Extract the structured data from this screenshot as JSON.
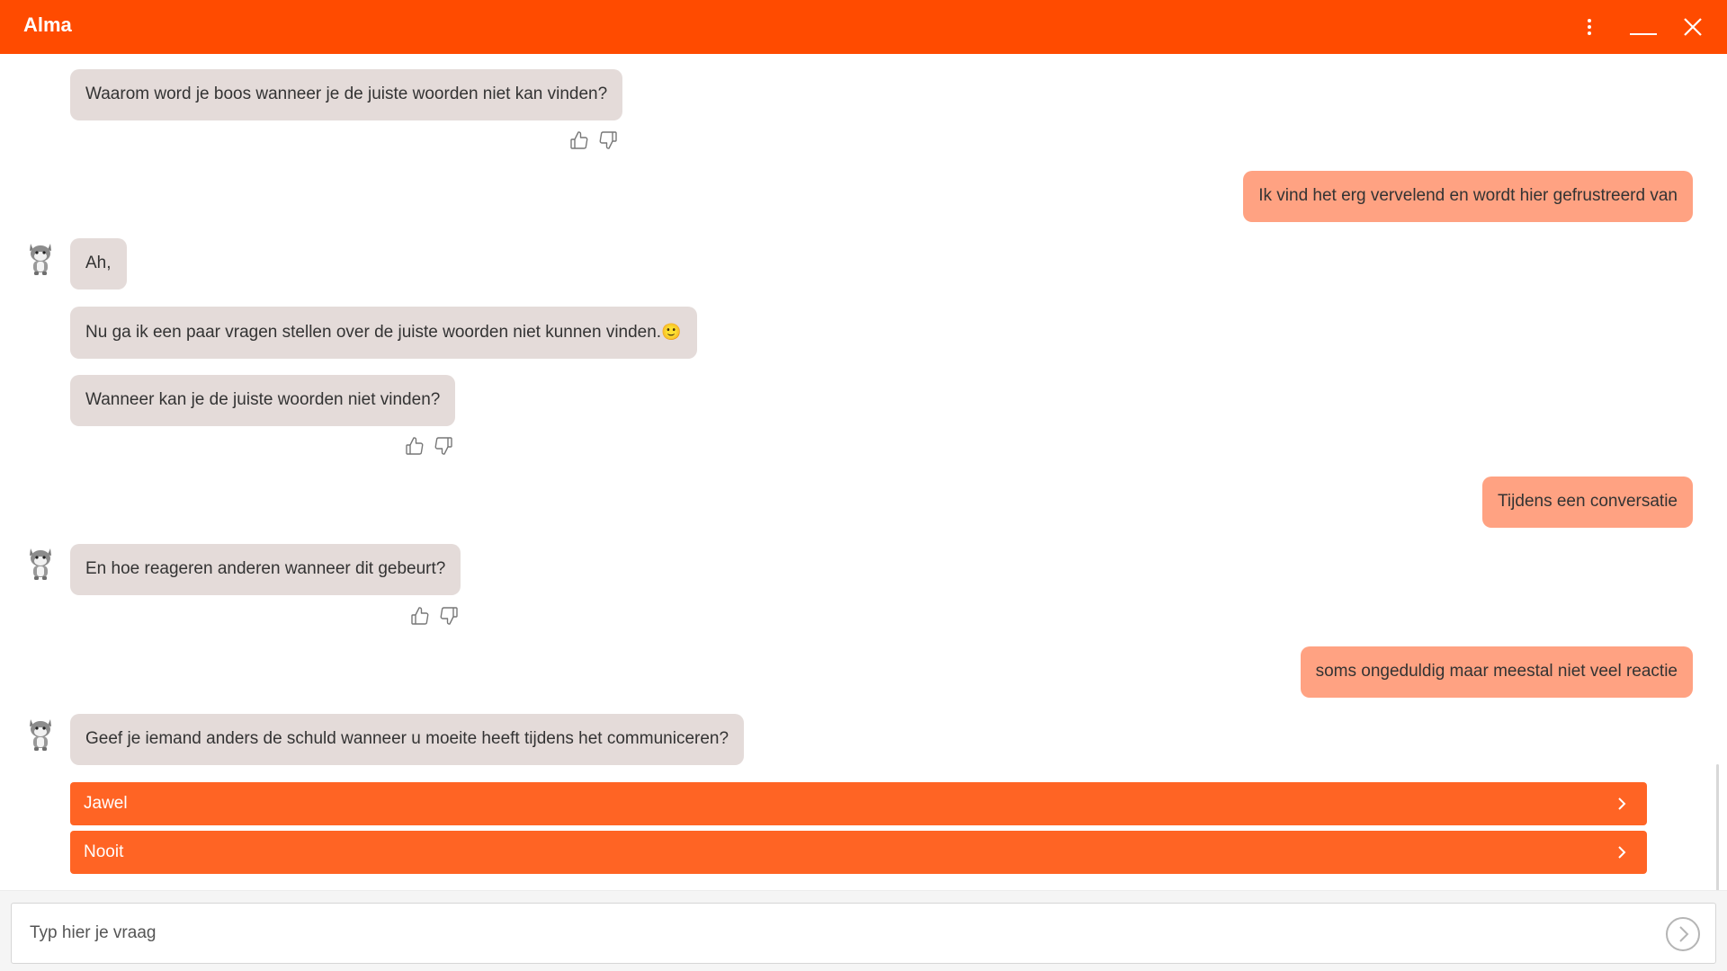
{
  "header": {
    "title": "Alma",
    "menu_icon": "more-vertical-icon",
    "minimize_icon": "minimize-icon",
    "close_icon": "close-icon"
  },
  "colors": {
    "header": "#ff4b00",
    "bot_bubble": "#e4dbd9",
    "user_bubble": "#ffa282",
    "option_button": "#ff6424"
  },
  "messages": [
    {
      "from": "bot",
      "text": "Waarom word je boos wanneer je de juiste woorden niet kan vinden?"
    },
    {
      "from": "user",
      "text": "Ik vind het erg vervelend en wordt hier gefrustreerd van"
    },
    {
      "from": "bot",
      "text": "Ah,"
    },
    {
      "from": "bot",
      "text": "Nu ga ik een paar vragen stellen over de juiste woorden niet kunnen vinden.",
      "emoji": "🙂"
    },
    {
      "from": "bot",
      "text": "Wanneer kan je de juiste woorden niet vinden?"
    },
    {
      "from": "user",
      "text": "Tijdens een conversatie"
    },
    {
      "from": "bot",
      "text": "En hoe reageren anderen wanneer dit gebeurt?"
    },
    {
      "from": "user",
      "text": "soms ongeduldig maar meestal niet veel reactie"
    },
    {
      "from": "bot",
      "text": "Geef je iemand anders de schuld wanneer u moeite heeft tijdens het communiceren?"
    }
  ],
  "options": [
    {
      "label": "Jawel"
    },
    {
      "label": "Nooit"
    }
  ],
  "input": {
    "placeholder": "Typ hier je vraag",
    "value": ""
  }
}
